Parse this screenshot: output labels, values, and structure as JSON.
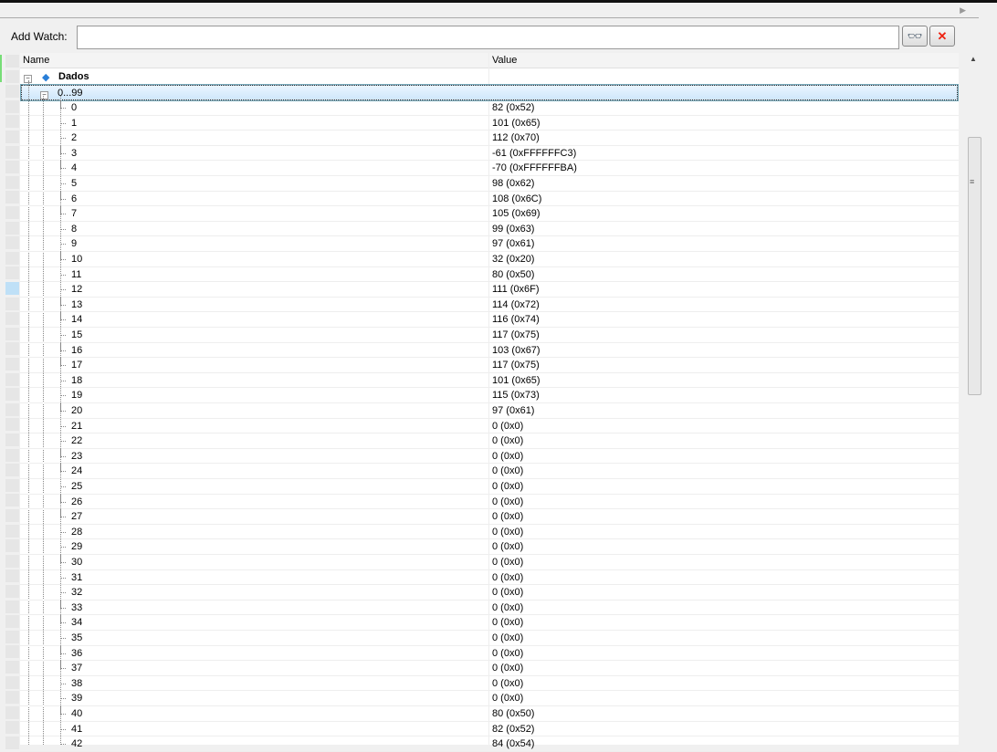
{
  "add_watch": {
    "label": "Add Watch:",
    "value": ""
  },
  "buttons": {
    "quickwatch_icon": "glasses-icon",
    "delete_icon": "close-icon"
  },
  "columns": {
    "name": "Name",
    "value": "Value"
  },
  "root": {
    "name": "Dados",
    "expander": "−"
  },
  "range": {
    "name": "0...99",
    "expander": "−"
  },
  "items": [
    {
      "name": "0",
      "value": "82 (0x52)"
    },
    {
      "name": "1",
      "value": "101 (0x65)"
    },
    {
      "name": "2",
      "value": "112 (0x70)"
    },
    {
      "name": "3",
      "value": "-61 (0xFFFFFFC3)"
    },
    {
      "name": "4",
      "value": "-70 (0xFFFFFFBA)"
    },
    {
      "name": "5",
      "value": "98 (0x62)"
    },
    {
      "name": "6",
      "value": "108 (0x6C)"
    },
    {
      "name": "7",
      "value": "105 (0x69)"
    },
    {
      "name": "8",
      "value": "99 (0x63)"
    },
    {
      "name": "9",
      "value": "97 (0x61)"
    },
    {
      "name": "10",
      "value": "32 (0x20)"
    },
    {
      "name": "11",
      "value": "80 (0x50)"
    },
    {
      "name": "12",
      "value": "111 (0x6F)"
    },
    {
      "name": "13",
      "value": "114 (0x72)"
    },
    {
      "name": "14",
      "value": "116 (0x74)"
    },
    {
      "name": "15",
      "value": "117 (0x75)"
    },
    {
      "name": "16",
      "value": "103 (0x67)"
    },
    {
      "name": "17",
      "value": "117 (0x75)"
    },
    {
      "name": "18",
      "value": "101 (0x65)"
    },
    {
      "name": "19",
      "value": "115 (0x73)"
    },
    {
      "name": "20",
      "value": "97 (0x61)"
    },
    {
      "name": "21",
      "value": "0 (0x0)"
    },
    {
      "name": "22",
      "value": "0 (0x0)"
    },
    {
      "name": "23",
      "value": "0 (0x0)"
    },
    {
      "name": "24",
      "value": "0 (0x0)"
    },
    {
      "name": "25",
      "value": "0 (0x0)"
    },
    {
      "name": "26",
      "value": "0 (0x0)"
    },
    {
      "name": "27",
      "value": "0 (0x0)"
    },
    {
      "name": "28",
      "value": "0 (0x0)"
    },
    {
      "name": "29",
      "value": "0 (0x0)"
    },
    {
      "name": "30",
      "value": "0 (0x0)"
    },
    {
      "name": "31",
      "value": "0 (0x0)"
    },
    {
      "name": "32",
      "value": "0 (0x0)"
    },
    {
      "name": "33",
      "value": "0 (0x0)"
    },
    {
      "name": "34",
      "value": "0 (0x0)"
    },
    {
      "name": "35",
      "value": "0 (0x0)"
    },
    {
      "name": "36",
      "value": "0 (0x0)"
    },
    {
      "name": "37",
      "value": "0 (0x0)"
    },
    {
      "name": "38",
      "value": "0 (0x0)"
    },
    {
      "name": "39",
      "value": "0 (0x0)"
    },
    {
      "name": "40",
      "value": "80 (0x50)"
    },
    {
      "name": "41",
      "value": "82 (0x52)"
    },
    {
      "name": "42",
      "value": "84 (0x54)"
    }
  ]
}
